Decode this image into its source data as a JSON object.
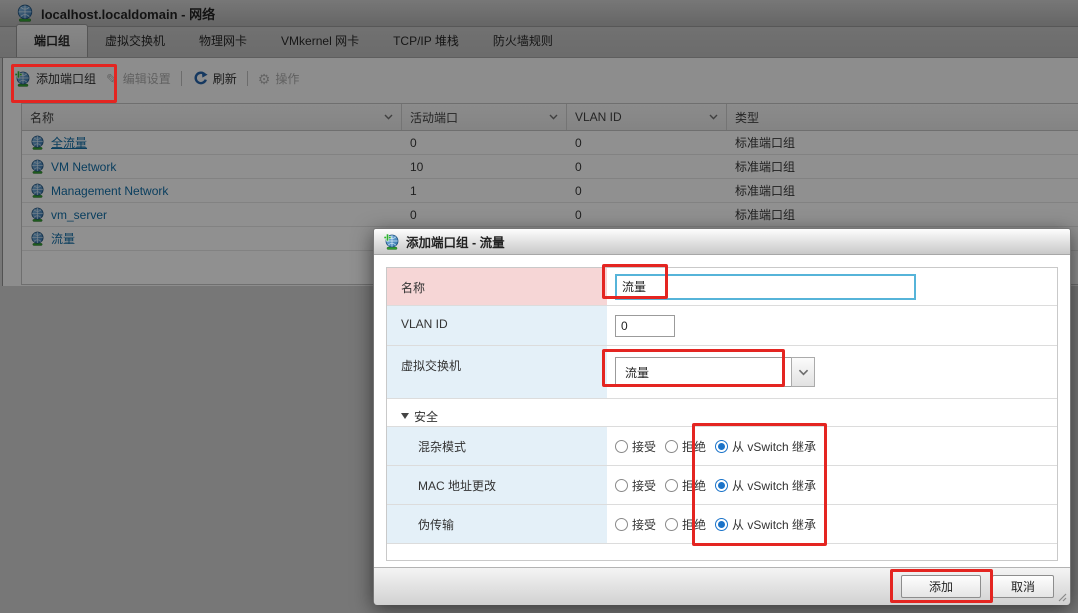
{
  "window": {
    "title": "localhost.localdomain - 网络"
  },
  "tabs": [
    {
      "label": "端口组",
      "active": true
    },
    {
      "label": "虚拟交换机"
    },
    {
      "label": "物理网卡"
    },
    {
      "label": "VMkernel 网卡"
    },
    {
      "label": "TCP/IP 堆栈"
    },
    {
      "label": "防火墙规则"
    }
  ],
  "toolbar": {
    "add_port_group": "添加端口组",
    "edit_settings": "编辑设置",
    "refresh": "刷新",
    "actions": "操作"
  },
  "table": {
    "columns": [
      "名称",
      "活动端口",
      "VLAN ID",
      "类型"
    ],
    "rows": [
      {
        "name": "全流量",
        "active_ports": "0",
        "vlan_id": "0",
        "type": "标准端口组"
      },
      {
        "name": "VM Network",
        "active_ports": "10",
        "vlan_id": "0",
        "type": "标准端口组"
      },
      {
        "name": "Management Network",
        "active_ports": "1",
        "vlan_id": "0",
        "type": "标准端口组"
      },
      {
        "name": "vm_server",
        "active_ports": "0",
        "vlan_id": "0",
        "type": "标准端口组"
      },
      {
        "name": "流量",
        "active_ports": "",
        "vlan_id": "",
        "type": ""
      }
    ]
  },
  "dialog": {
    "title": "添加端口组 - 流量",
    "fields": {
      "name": {
        "label": "名称",
        "value": "流量"
      },
      "vlan": {
        "label": "VLAN ID",
        "value": "0"
      },
      "vswitch": {
        "label": "虚拟交换机",
        "value": "流量"
      }
    },
    "security": {
      "section_label": "安全",
      "options": [
        "接受",
        "拒绝",
        "从 vSwitch 继承"
      ],
      "rows": [
        {
          "label": "混杂模式",
          "selected": "从 vSwitch 继承"
        },
        {
          "label": "MAC 地址更改",
          "selected": "从 vSwitch 继承"
        },
        {
          "label": "伪传输",
          "selected": "从 vSwitch 继承"
        }
      ]
    },
    "buttons": {
      "add": "添加",
      "cancel": "取消"
    }
  },
  "colors": {
    "annotation_red": "#e42521",
    "link_blue": "#0b6aa5",
    "focus_border_blue": "#56b4d9",
    "radio_blue": "#1a73c9",
    "label_pink": "#f6d6d6",
    "label_blue": "#e4f0f8"
  }
}
